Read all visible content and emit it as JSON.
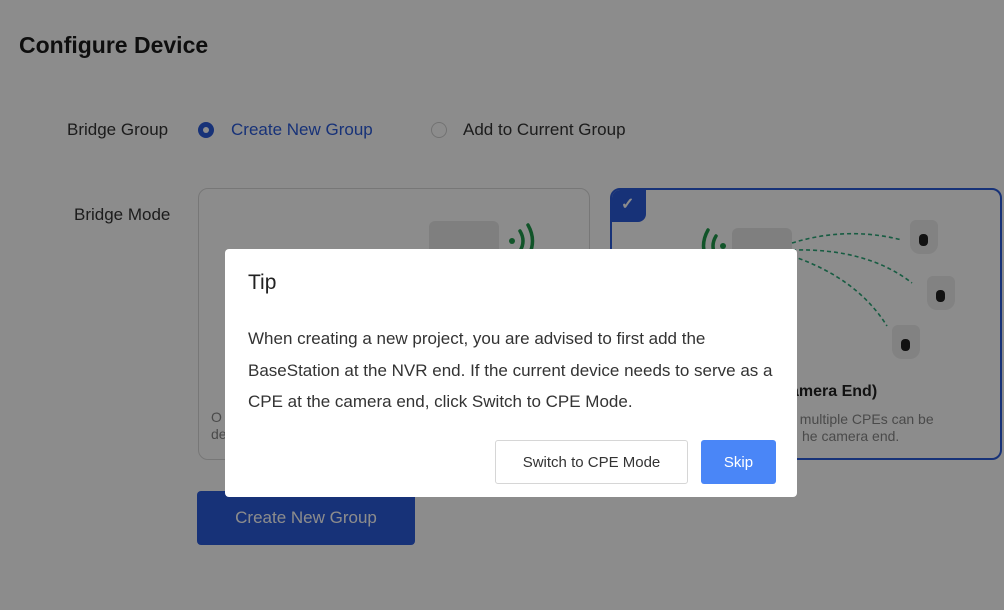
{
  "page": {
    "title": "Configure Device"
  },
  "bridge_group": {
    "label": "Bridge Group",
    "options": [
      {
        "label": "Create New Group",
        "selected": true
      },
      {
        "label": "Add to Current Group",
        "selected": false
      }
    ]
  },
  "bridge_mode": {
    "label": "Bridge Mode",
    "left_card": {
      "desc_line1": "O",
      "desc_line2": "de"
    },
    "right_card": {
      "title": "amera End)",
      "desc_line1": ", multiple CPEs can be",
      "desc_line2": "he camera end.",
      "selected_check": "✓"
    }
  },
  "create_button": {
    "label": "Create New Group"
  },
  "dialog": {
    "title": "Tip",
    "body": "When creating a new project, you are advised to first add the BaseStation at the NVR end. If the current device needs to serve as a CPE at the camera end, click Switch to CPE Mode.",
    "secondary_label": "Switch to CPE Mode",
    "primary_label": "Skip"
  },
  "colors": {
    "accent": "#2b5bdb",
    "skip_button": "#4a86f7",
    "wifi_green": "#1f9a4c"
  }
}
